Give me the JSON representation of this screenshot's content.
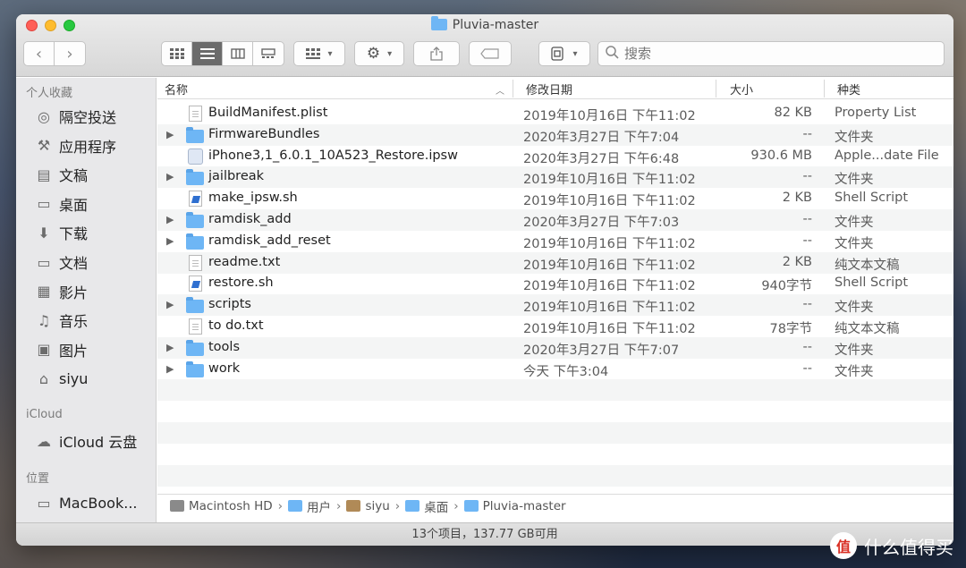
{
  "window": {
    "title": "Pluvia-master"
  },
  "search": {
    "placeholder": "搜索"
  },
  "sidebar": {
    "favorites_header": "个人收藏",
    "favorites": [
      {
        "label": "隔空投送",
        "icon": "airdrop-icon"
      },
      {
        "label": "应用程序",
        "icon": "applications-icon"
      },
      {
        "label": "文稿",
        "icon": "documents-icon"
      },
      {
        "label": "桌面",
        "icon": "desktop-icon"
      },
      {
        "label": "下载",
        "icon": "downloads-icon"
      },
      {
        "label": "文档",
        "icon": "folder-icon"
      },
      {
        "label": "影片",
        "icon": "movies-icon"
      },
      {
        "label": "音乐",
        "icon": "music-icon"
      },
      {
        "label": "图片",
        "icon": "pictures-icon"
      },
      {
        "label": "siyu",
        "icon": "home-icon"
      }
    ],
    "icloud_header": "iCloud",
    "icloud": [
      {
        "label": "iCloud 云盘",
        "icon": "cloud-icon"
      }
    ],
    "locations_header": "位置",
    "locations": [
      {
        "label": "MacBook...",
        "icon": "laptop-icon"
      }
    ]
  },
  "columns": {
    "name": "名称",
    "date": "修改日期",
    "size": "大小",
    "kind": "种类"
  },
  "files": [
    {
      "name": "BuildManifest.plist",
      "date": "2019年10月16日 下午11:02",
      "size": "82 KB",
      "kind": "Property List",
      "type": "doc",
      "expandable": false
    },
    {
      "name": "FirmwareBundles",
      "date": "2020年3月27日 下午7:04",
      "size": "--",
      "kind": "文件夹",
      "type": "folder",
      "expandable": true
    },
    {
      "name": "iPhone3,1_6.0.1_10A523_Restore.ipsw",
      "date": "2020年3月27日 下午6:48",
      "size": "930.6 MB",
      "kind": "Apple...date File",
      "type": "ipsw",
      "expandable": false
    },
    {
      "name": "jailbreak",
      "date": "2019年10月16日 下午11:02",
      "size": "--",
      "kind": "文件夹",
      "type": "folder",
      "expandable": true
    },
    {
      "name": "make_ipsw.sh",
      "date": "2019年10月16日 下午11:02",
      "size": "2 KB",
      "kind": "Shell Script",
      "type": "script",
      "expandable": false
    },
    {
      "name": "ramdisk_add",
      "date": "2020年3月27日 下午7:03",
      "size": "--",
      "kind": "文件夹",
      "type": "folder",
      "expandable": true
    },
    {
      "name": "ramdisk_add_reset",
      "date": "2019年10月16日 下午11:02",
      "size": "--",
      "kind": "文件夹",
      "type": "folder",
      "expandable": true
    },
    {
      "name": "readme.txt",
      "date": "2019年10月16日 下午11:02",
      "size": "2 KB",
      "kind": "纯文本文稿",
      "type": "doc",
      "expandable": false
    },
    {
      "name": "restore.sh",
      "date": "2019年10月16日 下午11:02",
      "size": "940字节",
      "kind": "Shell Script",
      "type": "script",
      "expandable": false
    },
    {
      "name": "scripts",
      "date": "2019年10月16日 下午11:02",
      "size": "--",
      "kind": "文件夹",
      "type": "folder",
      "expandable": true
    },
    {
      "name": "to do.txt",
      "date": "2019年10月16日 下午11:02",
      "size": "78字节",
      "kind": "纯文本文稿",
      "type": "doc",
      "expandable": false
    },
    {
      "name": "tools",
      "date": "2020年3月27日 下午7:07",
      "size": "--",
      "kind": "文件夹",
      "type": "folder",
      "expandable": true
    },
    {
      "name": "work",
      "date": "今天 下午3:04",
      "size": "--",
      "kind": "文件夹",
      "type": "folder",
      "expandable": true
    }
  ],
  "pathbar": [
    {
      "label": "Macintosh HD",
      "icon": "hard-drive-icon",
      "color": "#8a8a8a"
    },
    {
      "label": "用户",
      "icon": "folder-icon",
      "color": "#6eb6f5"
    },
    {
      "label": "siyu",
      "icon": "home-icon",
      "color": "#b08a57"
    },
    {
      "label": "桌面",
      "icon": "folder-icon",
      "color": "#6eb6f5"
    },
    {
      "label": "Pluvia-master",
      "icon": "folder-icon",
      "color": "#6eb6f5"
    }
  ],
  "status": {
    "text": "13个项目，137.77 GB可用"
  },
  "watermark": {
    "badge": "值",
    "text": "什么值得买"
  }
}
